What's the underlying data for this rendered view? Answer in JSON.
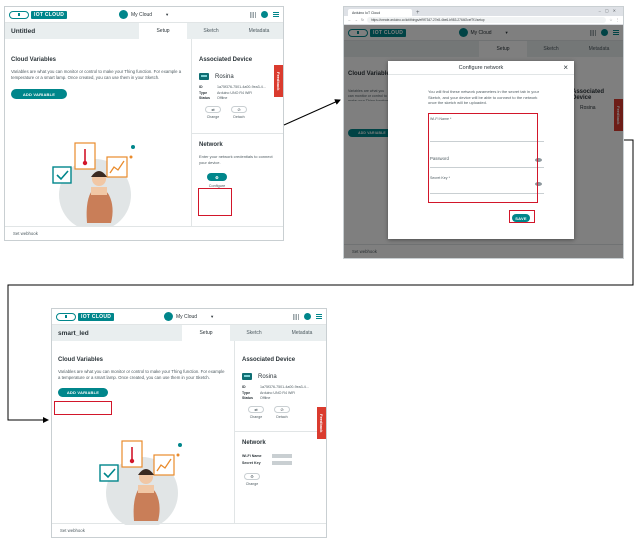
{
  "app": {
    "logo_text": "IOT CLOUD",
    "cloud_name": "My Cloud"
  },
  "panel1": {
    "thing_name": "Untitled",
    "tabs": [
      "Setup",
      "Sketch",
      "Metadata"
    ],
    "cloud_variables_title": "Cloud Variables",
    "cloud_variables_desc": "Variables are what you can monitor or control to make your Thing function. For example a temperature or a smart lamp. Once created, you can use them in your Sketch.",
    "add_variable": "ADD VARIABLE",
    "associated_device_title": "Associated Device",
    "device_name": "Rosina",
    "device_id_label": "ID",
    "device_id": "1a75f376-7501-4a00-9ea3-4...",
    "device_type_label": "Type",
    "device_type": "Arduino UNO R4 WiFi",
    "device_status_label": "Status",
    "device_status": "Offline",
    "change_label": "Change",
    "detach_label": "Detach",
    "network_title": "Network",
    "network_desc": "Enter your network credentials to connect your device.",
    "configure_label": "Configure",
    "set_webhook": "Set webhook",
    "feedback": "Feedback"
  },
  "panel2": {
    "browser_tab": "Arduino IoT Cloud",
    "url": "https://create.arduino.cc/iot/things/ef9f7347-27e8-4be6-b983-2764f2cef7f1/setup",
    "modal_title": "Configure network",
    "modal_close": "×",
    "modal_desc": "You will find these network parameters in the secret tab in your Sketch, and your device will be able to connect to the network once the sketch will be uploaded.",
    "wifi_name_label": "Wi-Fi Name *",
    "password_label": "Password",
    "secret_key_label": "Secret Key *",
    "save_label": "SAVE",
    "bg_cloud_variables": "Cloud Variables",
    "bg_associated": "Associated Device",
    "bg_device_name": "Rosina",
    "bg_desc": "Variables are what you can monitor or control to make your Thing function. For example a temperature or a smart lamp.",
    "bg_add_variable": "ADD VARIABLE",
    "bg_set_webhook": "Set webhook",
    "bg_tabs": [
      "Setup",
      "Sketch",
      "Metadata"
    ],
    "feedback": "Feedback"
  },
  "panel3": {
    "thing_name": "smart_led",
    "tabs": [
      "Setup",
      "Sketch",
      "Metadata"
    ],
    "cloud_variables_title": "Cloud Variables",
    "cloud_variables_desc": "Variables are what you can monitor or control to make your Thing function. For example a temperature or a smart lamp. Once created, you can use them in your Sketch.",
    "add_variable": "ADD VARIABLE",
    "associated_device_title": "Associated Device",
    "device_name": "Rosina",
    "device_id_label": "ID",
    "device_id": "1a75f376-7501-4a00-9ea3-4...",
    "device_type_label": "Type",
    "device_type": "Arduino UNO R4 WiFi",
    "device_status_label": "Status",
    "device_status": "Offline",
    "change_label": "Change",
    "detach_label": "Detach",
    "network_title": "Network",
    "wifi_name_label": "Wi-Fi Name",
    "secret_key_label": "Secret Key",
    "network_change_label": "Change",
    "set_webhook": "Set webhook",
    "feedback": "Feedback"
  },
  "colors": {
    "accent": "#00868b",
    "highlight": "#d2162a",
    "feedback": "#da3b2e"
  }
}
